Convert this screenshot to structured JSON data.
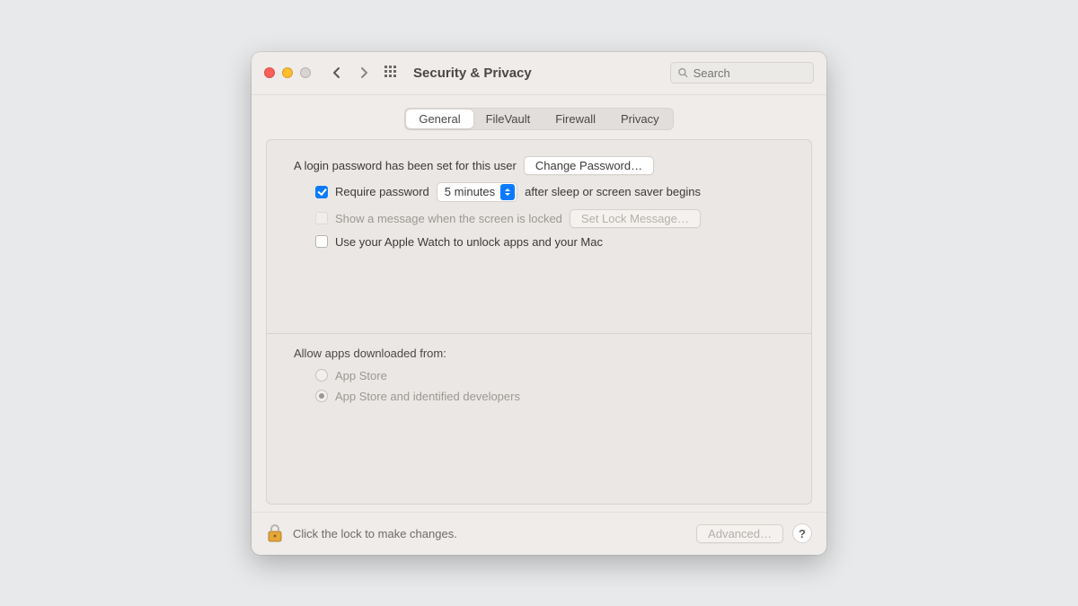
{
  "window": {
    "title": "Security & Privacy",
    "search_placeholder": "Search"
  },
  "tabs": {
    "general": "General",
    "filevault": "FileVault",
    "firewall": "Firewall",
    "privacy": "Privacy",
    "active": "general"
  },
  "security": {
    "login_password_text": "A login password has been set for this user",
    "change_password_btn": "Change Password…",
    "require_password_label": "Require password",
    "require_password_delay": "5 minutes",
    "require_password_suffix": "after sleep or screen saver begins",
    "show_message_label": "Show a message when the screen is locked",
    "set_lock_msg_btn": "Set Lock Message…",
    "apple_watch_label": "Use your Apple Watch to unlock apps and your Mac",
    "allow_apps_heading": "Allow apps downloaded from:",
    "radio_app_store": "App Store",
    "radio_identified": "App Store and identified developers"
  },
  "footer": {
    "lock_text": "Click the lock to make changes.",
    "advanced_btn": "Advanced…",
    "help": "?"
  }
}
